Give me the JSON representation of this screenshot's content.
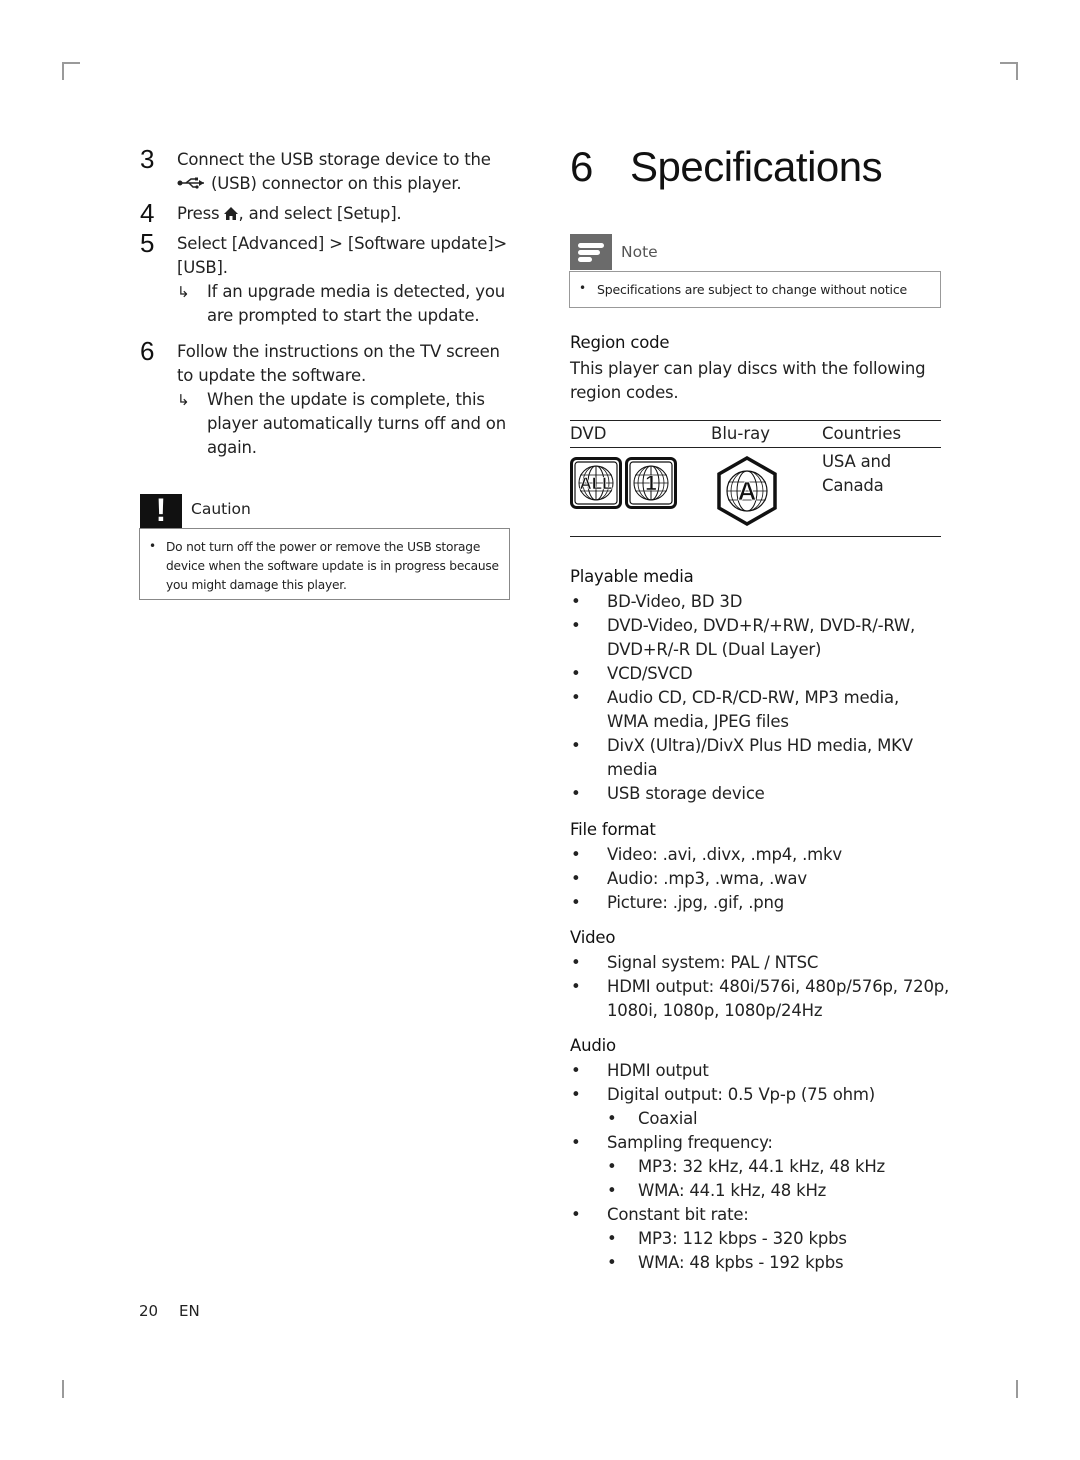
{
  "page": {
    "page_number": "20",
    "language": "EN"
  },
  "left_column": {
    "steps": [
      {
        "number": "3",
        "lines": [
          "Connect the USB storage device to the",
          "(USB) connector on this player."
        ]
      },
      {
        "number": "4",
        "text": "Press",
        "text_after": ", and select [Setup]."
      },
      {
        "number": "5",
        "lines": [
          "Select [Advanced] > [Software update]>",
          "[USB]."
        ]
      },
      {
        "number": "6",
        "lines": [
          "Follow the instructions on the TV screen",
          "to update the software."
        ]
      }
    ],
    "results": [
      {
        "lines": [
          "If an upgrade media is detected, you",
          "are prompted to start the update."
        ]
      },
      {
        "lines": [
          "When the update is complete, this",
          "player automatically turns off and on",
          "again."
        ]
      }
    ],
    "caution": {
      "title": "Caution",
      "icon": "exclamation-icon",
      "lines": [
        "Do not turn off the power or remove the USB storage",
        "device when the software update is in progress because",
        "you might damage this player."
      ]
    },
    "icons": {
      "usb": "usb-icon",
      "home": "home-icon",
      "arrow": "↳"
    }
  },
  "right_column": {
    "chapter_number": "6",
    "chapter_title": "Specifications",
    "note": {
      "title": "Note",
      "icon": "note-icon",
      "text": "Specifications are subject to change without notice"
    },
    "region_code": {
      "title": "Region code",
      "lines": [
        "This player can play discs with the following",
        "region codes."
      ],
      "table": {
        "headers": [
          "DVD",
          "Blu-ray",
          "Countries"
        ],
        "rows": [
          {
            "dvd_icons": [
              "ALL",
              "1"
            ],
            "bluray_icon": "A",
            "countries_lines": [
              "USA and",
              "Canada"
            ]
          }
        ]
      }
    },
    "playable_media": {
      "title": "Playable media",
      "items": [
        {
          "lines": [
            "BD-Video, BD 3D"
          ]
        },
        {
          "lines": [
            "DVD-Video, DVD+R/+RW, DVD-R/-RW,",
            "DVD+R/-R DL (Dual Layer)"
          ]
        },
        {
          "lines": [
            "VCD/SVCD"
          ]
        },
        {
          "lines": [
            "Audio CD, CD-R/CD-RW, MP3 media,",
            "WMA media, JPEG files"
          ]
        },
        {
          "lines": [
            "DivX (Ultra)/DivX Plus HD media, MKV",
            "media"
          ]
        },
        {
          "lines": [
            "USB storage device"
          ]
        }
      ]
    },
    "file_format": {
      "title": "File format",
      "items": [
        "Video: .avi, .divx, .mp4, .mkv",
        "Audio: .mp3, .wma, .wav",
        "Picture: .jpg, .gif, .png"
      ]
    },
    "video": {
      "title": "Video",
      "items": [
        {
          "lines": [
            "Signal system: PAL / NTSC"
          ]
        },
        {
          "lines": [
            "HDMI output: 480i/576i, 480p/576p, 720p,",
            "1080i, 1080p, 1080p/24Hz"
          ]
        }
      ]
    },
    "audio": {
      "title": "Audio",
      "items": [
        {
          "text": "HDMI output",
          "sub": []
        },
        {
          "text": "Digital output: 0.5 Vp-p (75 ohm)",
          "sub": [
            "Coaxial"
          ]
        },
        {
          "text": "Sampling frequency:",
          "sub": [
            "MP3: 32 kHz, 44.1 kHz, 48 kHz",
            "WMA: 44.1 kHz, 48 kHz"
          ]
        },
        {
          "text": "Constant bit rate:",
          "sub": [
            "MP3: 112 kbps - 320 kpbs",
            "WMA: 48 kpbs - 192 kpbs"
          ]
        }
      ]
    }
  }
}
